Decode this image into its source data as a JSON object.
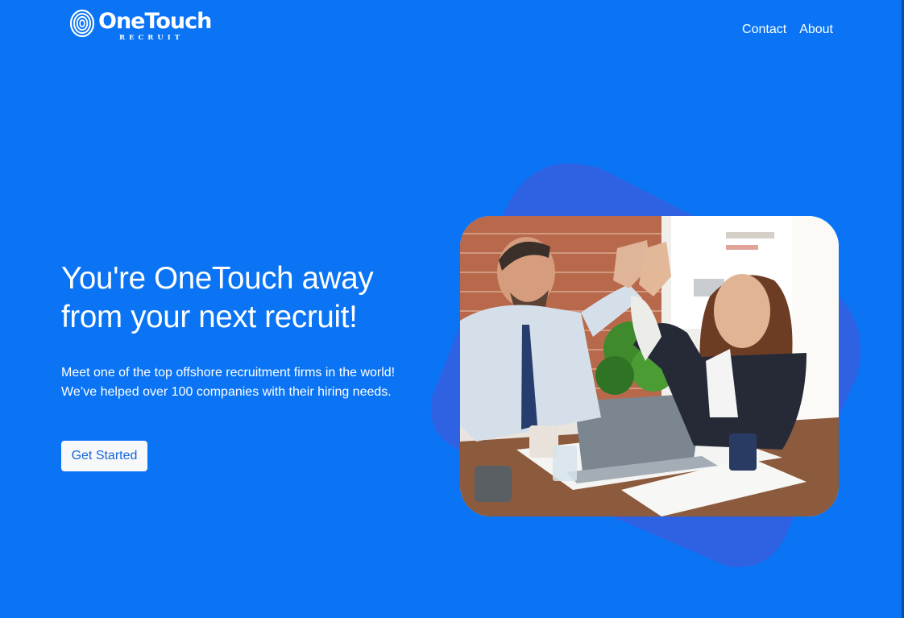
{
  "brand": {
    "name": "OneTouch",
    "tagline": "RECRUIT"
  },
  "nav": {
    "items": [
      {
        "label": "Contact"
      },
      {
        "label": "About"
      }
    ]
  },
  "hero": {
    "title": "You're OneTouch away from your next recruit!",
    "description_line1": "Meet one of the top offshore recruitment firms in the world!",
    "description_line2": "We’ve helped over 100 companies with their hiring needs.",
    "cta_label": "Get Started"
  },
  "colors": {
    "background": "#0a74f5",
    "blob": "#2f62e3",
    "cta_text": "#1766d9",
    "cta_bg": "#f7f8fa"
  },
  "image": {
    "subject": "two colleagues giving a high five at an office desk"
  }
}
